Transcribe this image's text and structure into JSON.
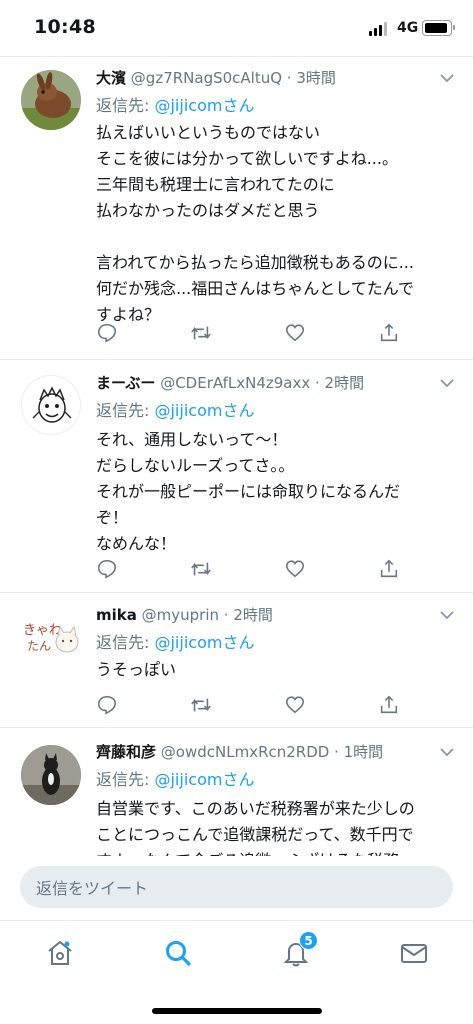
{
  "status_bar": {
    "time": "10:48",
    "network": "4G"
  },
  "colors": {
    "accent": "#1da1f2",
    "muted": "#657786",
    "divider": "#e6ecf0"
  },
  "tweets": [
    {
      "name": "大濱",
      "handle": "@gz7RNagS0cAltuQ",
      "time": "3時間",
      "reply_prefix": "返信先: ",
      "reply_to": "@jijicomさん",
      "body": "払えばいいというものではない\nそこを彼には分かって欲しいですよね...。\n三年間も税理士に言われてたのに\n払わなかったのはダメだと思う\n\n言われてから払ったら追加徴税もあるのに...\n何だか残念...福田さんはちゃんとしてたんで\nすよね？",
      "avatar_icon": "rabbit-photo"
    },
    {
      "name": "まーぶー",
      "handle": "@CDErAfLxN4z9axx",
      "time": "2時間",
      "reply_prefix": "返信先: ",
      "reply_to": "@jijicomさん",
      "body": "それ、通用しないって〜！\nだらしないルーズってさ。。\nそれが一般ピーポーには命取りになるんだ\nぞ！\nなめんな！",
      "avatar_icon": "sketch-character"
    },
    {
      "name": "mika",
      "handle": "@myuprin",
      "time": "2時間",
      "reply_prefix": "返信先: ",
      "reply_to": "@jijicomさん",
      "body": "うそっぽい",
      "avatar_icon": "cat-illustration"
    },
    {
      "name": "齊藤和彦",
      "handle": "@owdcNLmxRcn2RDD",
      "time": "1時間",
      "reply_prefix": "返信先: ",
      "reply_to": "@jijicomさん",
      "body": "自営業です、このあいだ税務署が来た少しの\nことにつっこんで追徴課税だって、数千円で\nすよ、なんで今ごろ追徴、ふざけるな税務",
      "avatar_icon": "dog-photo"
    }
  ],
  "reply_bar": {
    "placeholder": "返信をツイート"
  },
  "tabbar": {
    "notification_count": "5"
  }
}
